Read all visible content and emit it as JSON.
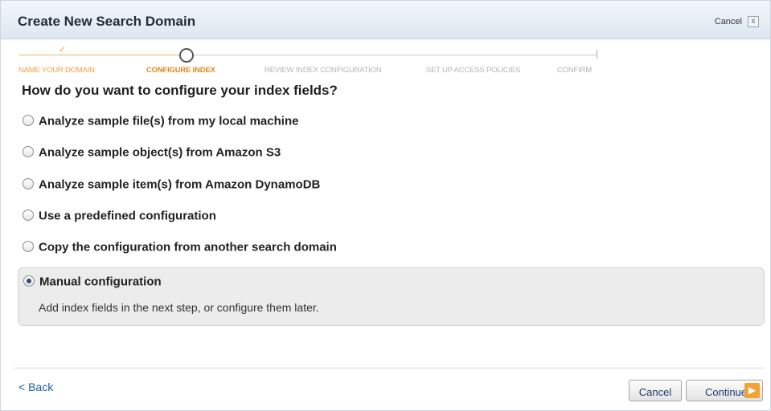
{
  "dialog": {
    "title": "Create New Search Domain",
    "cancel_label": "Cancel",
    "close_glyph": "x"
  },
  "wizard": {
    "steps": [
      {
        "label": "Name Your Domain",
        "state": "done"
      },
      {
        "label": "Configure Index",
        "state": "current"
      },
      {
        "label": "Review Index Configuration",
        "state": "todo"
      },
      {
        "label": "Set Up Access Policies",
        "state": "todo"
      },
      {
        "label": "Confirm",
        "state": "todo"
      }
    ],
    "done_color": "#f0a040",
    "current_color": "#e08b1c",
    "check_glyph": "✓"
  },
  "main": {
    "question": "How do you want to configure your index fields?",
    "options": [
      {
        "label": "Analyze sample file(s) from my local machine",
        "selected": false
      },
      {
        "label": "Analyze sample object(s) from Amazon S3",
        "selected": false
      },
      {
        "label": "Analyze sample item(s) from Amazon DynamoDB",
        "selected": false
      },
      {
        "label": "Use a predefined configuration",
        "selected": false
      },
      {
        "label": "Copy the configuration from another search domain",
        "selected": false
      },
      {
        "label": "Manual configuration",
        "selected": true,
        "description": "Add index fields in the next step, or configure them later."
      }
    ]
  },
  "footer": {
    "back_label": "< Back",
    "cancel_label": "Cancel",
    "continue_label": "Continue",
    "continue_icon": "arrow-right-icon",
    "accent": "#f2a330",
    "link_color": "#1a5ea9"
  }
}
